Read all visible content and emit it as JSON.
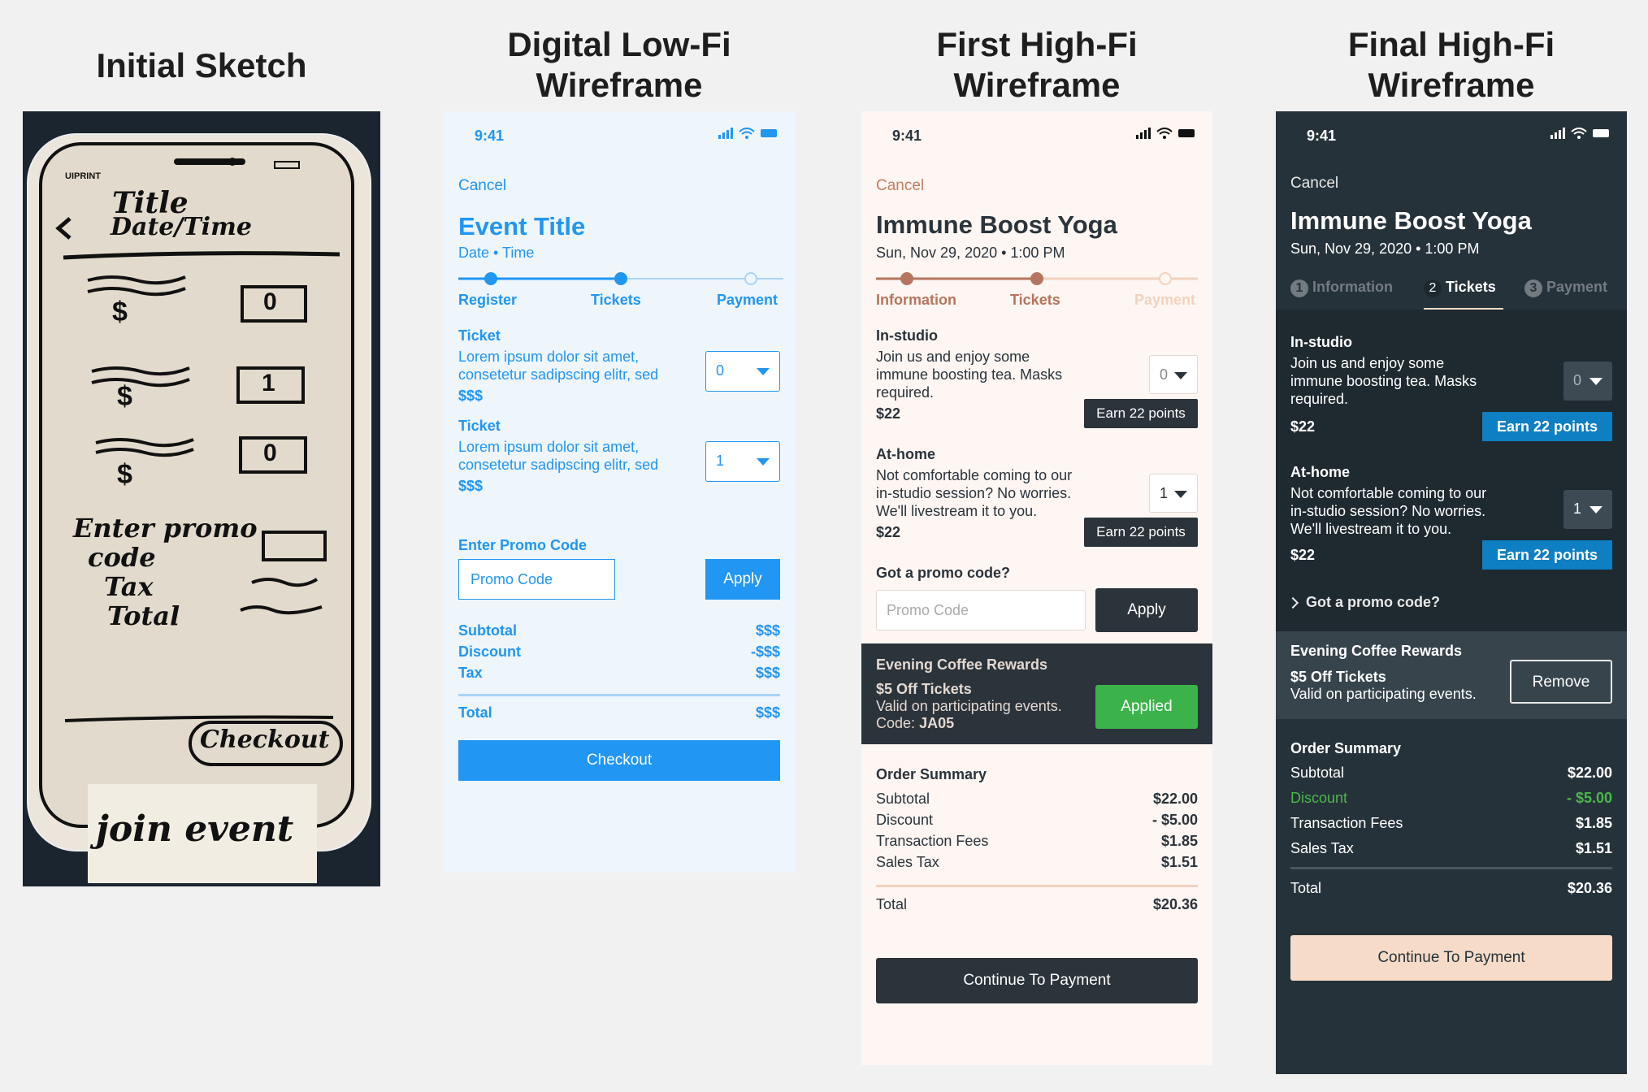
{
  "headings": {
    "sketch": "Initial Sketch",
    "lofi": [
      "Digital Low-Fi",
      "Wireframe"
    ],
    "hifi1": [
      "First High-Fi",
      "Wireframe"
    ],
    "hifi2": [
      "Final High-Fi",
      "Wireframe"
    ]
  },
  "sketch": {
    "brand": "UIPRINT",
    "title": "Title",
    "datetime": "Date/Time",
    "price": "$",
    "qty": [
      "0",
      "1",
      "0"
    ],
    "promo": [
      "Enter promo",
      "code"
    ],
    "tax": "Tax",
    "total": "Total",
    "checkout": "Checkout",
    "caption": "join event"
  },
  "lofi": {
    "time": "9:41",
    "cancel": "Cancel",
    "title": "Event Title",
    "subtitle": "Date • Time",
    "steps": [
      "Register",
      "Tickets",
      "Payment"
    ],
    "tickets": [
      {
        "name": "Ticket",
        "desc1": "Lorem ipsum dolor sit amet,",
        "desc2": "consetetur sadipscing elitr, sed",
        "price": "$$$",
        "qty": "0"
      },
      {
        "name": "Ticket",
        "desc1": "Lorem ipsum dolor sit amet,",
        "desc2": "consetetur sadipscing elitr, sed",
        "price": "$$$",
        "qty": "1"
      }
    ],
    "promo_label": "Enter Promo Code",
    "promo_placeholder": "Promo Code",
    "apply": "Apply",
    "summary": [
      {
        "label": "Subtotal",
        "value": "$$$"
      },
      {
        "label": "Discount",
        "value": "-$$$"
      },
      {
        "label": "Tax",
        "value": "$$$"
      }
    ],
    "total_label": "Total",
    "total_value": "$$$",
    "checkout": "Checkout"
  },
  "hifi1": {
    "time": "9:41",
    "cancel": "Cancel",
    "title": "Immune Boost Yoga",
    "subtitle": "Sun, Nov 29, 2020 • 1:00 PM",
    "steps": [
      "Information",
      "Tickets",
      "Payment"
    ],
    "tickets": [
      {
        "name": "In-studio",
        "desc": [
          "Join us and enjoy some",
          "immune boosting tea. Masks",
          "required."
        ],
        "price": "$22",
        "qty": "0",
        "points": "Earn 22 points"
      },
      {
        "name": "At-home",
        "desc": [
          "Not comfortable coming to our",
          "in-studio session? No worries.",
          "We'll livestream it to you."
        ],
        "price": "$22",
        "qty": "1",
        "points": "Earn 22 points"
      }
    ],
    "promo_label": "Got a promo code?",
    "promo_placeholder": "Promo Code",
    "apply": "Apply",
    "reward": {
      "title": "Evening Coffee Rewards",
      "offer": "$5 Off Tickets",
      "valid": "Valid on participating events.",
      "code_label": "Code:",
      "code": "JA05",
      "status": "Applied"
    },
    "summary_title": "Order Summary",
    "summary": [
      {
        "label": "Subtotal",
        "value": "$22.00"
      },
      {
        "label": "Discount",
        "value": "- $5.00"
      },
      {
        "label": "Transaction Fees",
        "value": "$1.85"
      },
      {
        "label": "Sales Tax",
        "value": "$1.51"
      }
    ],
    "total_label": "Total",
    "total_value": "$20.36",
    "continue": "Continue To Payment"
  },
  "hifi2": {
    "time": "9:41",
    "cancel": "Cancel",
    "title": "Immune Boost Yoga",
    "subtitle": "Sun, Nov 29, 2020 • 1:00 PM",
    "tabs": [
      {
        "num": "1",
        "label": "Information"
      },
      {
        "num": "2",
        "label": "Tickets"
      },
      {
        "num": "3",
        "label": "Payment"
      }
    ],
    "tickets": [
      {
        "name": "In-studio",
        "desc": [
          "Join us and enjoy some",
          "immune boosting tea. Masks",
          "required."
        ],
        "price": "$22",
        "qty": "0",
        "points": "Earn 22 points"
      },
      {
        "name": "At-home",
        "desc": [
          "Not comfortable coming to our",
          "in-studio session? No worries.",
          "We'll livestream it to you."
        ],
        "price": "$22",
        "qty": "1",
        "points": "Earn 22 points"
      }
    ],
    "promo_label": "Got a promo code?",
    "reward": {
      "title": "Evening Coffee Rewards",
      "offer": "$5 Off Tickets",
      "valid": "Valid on participating events.",
      "action": "Remove"
    },
    "summary_title": "Order Summary",
    "summary": [
      {
        "label": "Subtotal",
        "value": "$22.00"
      },
      {
        "label": "Discount",
        "value": "- $5.00"
      },
      {
        "label": "Transaction Fees",
        "value": "$1.85"
      },
      {
        "label": "Sales Tax",
        "value": "$1.51"
      }
    ],
    "total_label": "Total",
    "total_value": "$20.36",
    "continue": "Continue To Payment",
    "colors": {
      "background": "#26323a",
      "accent_blue": "#0d7fc2",
      "discount_green": "#4ab84a",
      "cta": "#f6dcc8"
    }
  }
}
